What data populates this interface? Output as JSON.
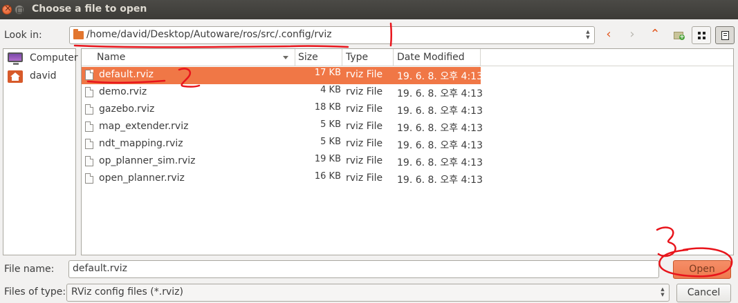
{
  "window": {
    "title": "Choose a file to open"
  },
  "toolbar": {
    "look_in_label": "Look in:",
    "path": "/home/david/Desktop/Autoware/ros/src/.config/rviz"
  },
  "places": [
    {
      "label": "Computer",
      "icon": "computer-icon"
    },
    {
      "label": "david",
      "icon": "home-folder-icon"
    }
  ],
  "file_list": {
    "columns": {
      "name": "Name",
      "size": "Size",
      "type": "Type",
      "date": "Date Modified"
    },
    "rows": [
      {
        "name": "default.rviz",
        "size": "17 KB",
        "type": "rviz File",
        "date": "19. 6. 8. 오후 4:13",
        "selected": true
      },
      {
        "name": "demo.rviz",
        "size": "4 KB",
        "type": "rviz File",
        "date": "19. 6. 8. 오후 4:13"
      },
      {
        "name": "gazebo.rviz",
        "size": "18 KB",
        "type": "rviz File",
        "date": "19. 6. 8. 오후 4:13"
      },
      {
        "name": "map_extender.rviz",
        "size": "5 KB",
        "type": "rviz File",
        "date": "19. 6. 8. 오후 4:13"
      },
      {
        "name": "ndt_mapping.rviz",
        "size": "5 KB",
        "type": "rviz File",
        "date": "19. 6. 8. 오후 4:13"
      },
      {
        "name": "op_planner_sim.rviz",
        "size": "19 KB",
        "type": "rviz File",
        "date": "19. 6. 8. 오후 4:13"
      },
      {
        "name": "open_planner.rviz",
        "size": "16 KB",
        "type": "rviz File",
        "date": "19. 6. 8. 오후 4:13"
      }
    ]
  },
  "footer": {
    "file_name_label": "File name:",
    "file_name_value": "default.rviz",
    "files_of_type_label": "Files of type:",
    "files_of_type_value": "RViz config files (*.rviz)",
    "open_label": "Open",
    "cancel_label": "Cancel"
  },
  "annotations": {
    "mark_1": "1",
    "mark_2": "2",
    "mark_3": "3"
  },
  "colors": {
    "accent": "#f07746",
    "annotation": "#e8141b"
  }
}
